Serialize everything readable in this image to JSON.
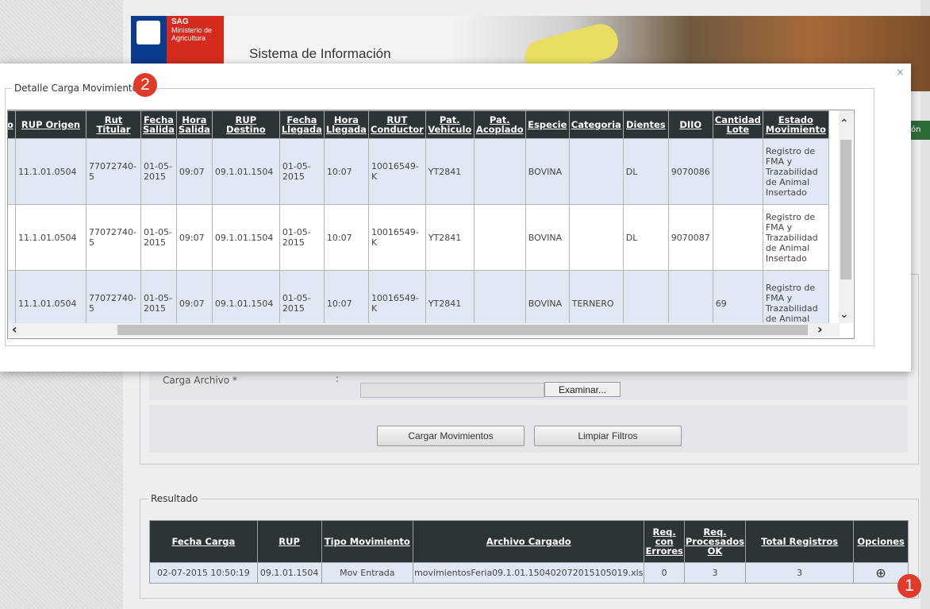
{
  "header": {
    "logo_line1": "SAG",
    "logo_line2": "Ministerio de",
    "logo_line3": "Agricultura",
    "system_title": "Sistema de Información"
  },
  "right_edge_button": "ón",
  "modal": {
    "legend": "Detalle Carga Movimiento",
    "close": "×",
    "columns": [
      "o",
      "RUP Origen",
      "Rut Titular",
      "Fecha Salida",
      "Hora Salida",
      "RUP Destino",
      "Fecha Llegada",
      "Hora Llegada",
      "RUT Conductor",
      "Pat. Vehiculo",
      "Pat. Acoplado",
      "Especie",
      "Categoria",
      "Dientes",
      "DIIO",
      "Cantidad Lote",
      "Estado Movimiento"
    ],
    "rows": [
      {
        "rup_origen": "11.1.01.0504",
        "rut_titular": "77072740-5",
        "fecha_salida": "01-05-2015",
        "hora_salida": "09:07",
        "rup_destino": "09.1.01.1504",
        "fecha_llegada": "01-05-2015",
        "hora_llegada": "10:07",
        "rut_conductor": "10016549-K",
        "pat_vehiculo": "YT2841",
        "pat_acoplado": "",
        "especie": "BOVINA",
        "categoria": "",
        "dientes": "DL",
        "diio": "9070086",
        "cantidad_lote": "",
        "estado": "Registro de FMA y Trazabilidad de Animal Insertado"
      },
      {
        "rup_origen": "11.1.01.0504",
        "rut_titular": "77072740-5",
        "fecha_salida": "01-05-2015",
        "hora_salida": "09:07",
        "rup_destino": "09.1.01.1504",
        "fecha_llegada": "01-05-2015",
        "hora_llegada": "10:07",
        "rut_conductor": "10016549-K",
        "pat_vehiculo": "YT2841",
        "pat_acoplado": "",
        "especie": "BOVINA",
        "categoria": "",
        "dientes": "DL",
        "diio": "9070087",
        "cantidad_lote": "",
        "estado": "Registro de FMA y Trazabilidad de Animal Insertado"
      },
      {
        "rup_origen": "11.1.01.0504",
        "rut_titular": "77072740-5",
        "fecha_salida": "01-05-2015",
        "hora_salida": "09:07",
        "rup_destino": "09.1.01.1504",
        "fecha_llegada": "01-05-2015",
        "hora_llegada": "10:07",
        "rut_conductor": "10016549-K",
        "pat_vehiculo": "YT2841",
        "pat_acoplado": "",
        "especie": "BOVINA",
        "categoria": "TERNERO",
        "dientes": "",
        "diio": "",
        "cantidad_lote": "69",
        "estado": "Registro de FMA y Trazabilidad de Animal"
      }
    ]
  },
  "form": {
    "carga_archivo_label": "Carga Archivo *",
    "colon": ":",
    "browse_button": "Examinar...",
    "cargar_button": "Cargar Movimientos",
    "limpiar_button": "Limpiar Filtros"
  },
  "result": {
    "legend": "Resultado",
    "columns": [
      "Fecha Carga",
      "RUP",
      "Tipo Movimiento",
      "Archivo Cargado",
      "Req. con Errores",
      "Req. Procesados OK",
      "Total Registros",
      "Opciones"
    ],
    "row": {
      "fecha_carga": "02-07-2015 10:50:19",
      "rup": "09.1.01.1504",
      "tipo": "Mov Entrada",
      "archivo": "movimientosFeria09.1.01.150402072015105019.xls",
      "errores": "0",
      "procesados": "3",
      "total": "3",
      "opciones_icon": "zoom-in-icon"
    }
  },
  "badges": {
    "one": "1",
    "two": "2"
  }
}
